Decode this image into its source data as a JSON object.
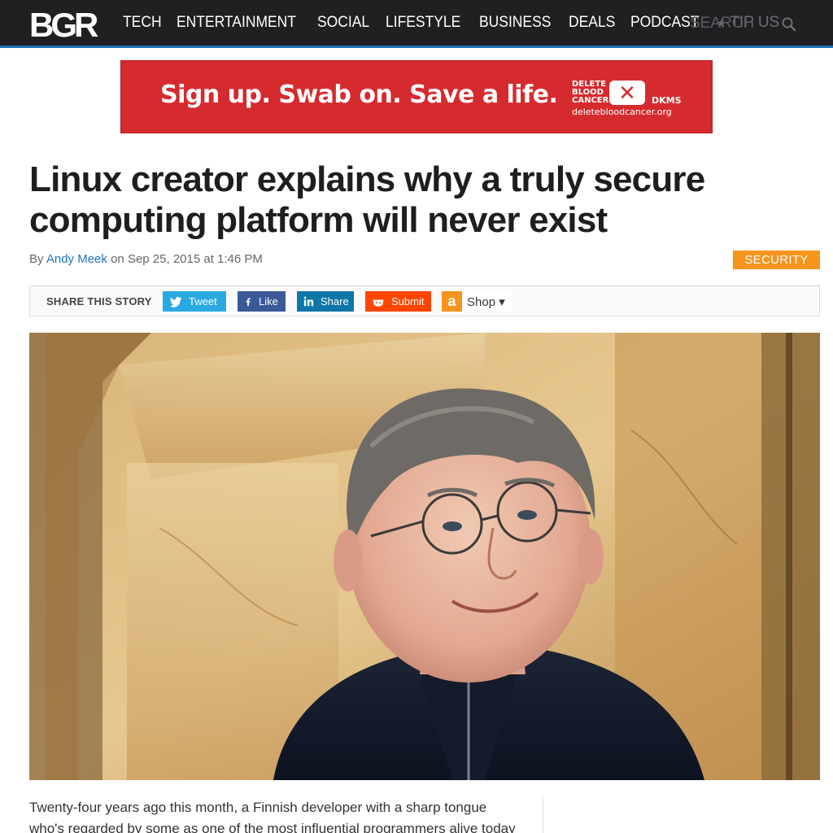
{
  "header": {
    "logo": "BGR",
    "nav": [
      "TECH",
      "ENTERTAINMENT",
      "SOCIAL",
      "LIFESTYLE",
      "BUSINESS",
      "DEALS",
      "PODCAST"
    ],
    "tip_us": "TIP US",
    "search_placeholder": "SEARCH",
    "colors": {
      "bar": "#1f2022",
      "accent": "#1e73be"
    }
  },
  "ad": {
    "text": "Sign up. Swab on. Save a life.",
    "brand_line1": "DELETE",
    "brand_line2": "BLOOD",
    "brand_line3": "CANCER",
    "brand_short": "DKMS",
    "url": "deletebloodcancer.org",
    "color": "#d52b2e"
  },
  "article": {
    "headline": "Linux creator explains why a truly secure computing platform will never exist",
    "byline_prefix": "By",
    "author": "Andy Meek",
    "date_prefix": "on",
    "date": "Sep 25, 2015 at 1:46 PM",
    "category": "SECURITY",
    "body": "Twenty-four years ago this month, a Finnish developer with a sharp tongue who's regarded by some as one of the most influential programmers alive today released"
  },
  "share": {
    "label": "SHARE THIS STORY",
    "buttons": [
      {
        "label": "Tweet",
        "icon": "twitter-icon",
        "color": "#2aa9e0"
      },
      {
        "label": "Like",
        "icon": "facebook-icon",
        "color": "#3b5998"
      },
      {
        "label": "Share",
        "icon": "linkedin-icon",
        "color": "#0e76a8"
      },
      {
        "label": "Submit",
        "icon": "reddit-icon",
        "color": "#ff4500"
      }
    ],
    "shop_label": "Shop ▾",
    "shop_icon": "amazon-icon"
  },
  "hero": {
    "subject": "portrait-photo"
  }
}
